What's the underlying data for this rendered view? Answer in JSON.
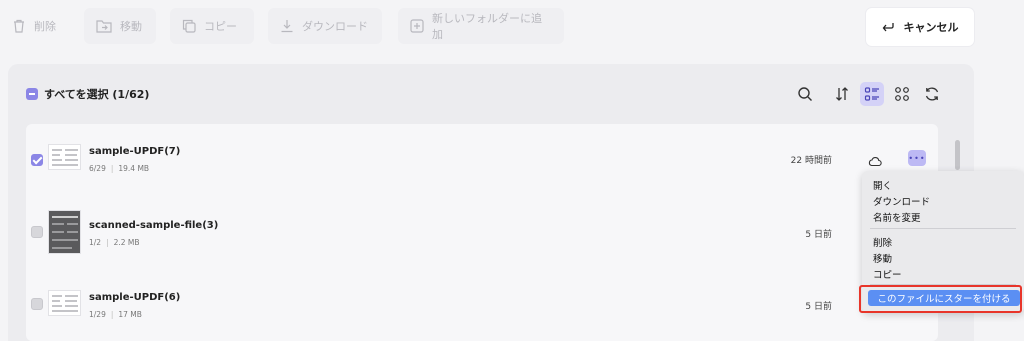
{
  "toolbar": {
    "delete_label": "削除",
    "move_label": "移動",
    "copy_label": "コピー",
    "download_label": "ダウンロード",
    "new_folder_label": "新しいフォルダーに追加",
    "cancel_label": "キャンセル"
  },
  "header": {
    "select_all_label": "すべてを選択 (1/62)"
  },
  "files": [
    {
      "name": "sample-UPDF(7)",
      "pages": "6/29",
      "size": "19.4 MB",
      "date": "22 時間前",
      "checked": true
    },
    {
      "name": "scanned-sample-file(3)",
      "pages": "1/2",
      "size": "2.2 MB",
      "date": "5 日前",
      "checked": false
    },
    {
      "name": "sample-UPDF(6)",
      "pages": "1/29",
      "size": "17 MB",
      "date": "5 日前",
      "checked": false
    }
  ],
  "context_menu": {
    "open": "開く",
    "download": "ダウンロード",
    "rename": "名前を変更",
    "delete": "削除",
    "move": "移動",
    "copy": "コピー",
    "star": "このファイルにスターを付ける"
  },
  "colors": {
    "accent": "#8b86e6",
    "menu_highlight": "#5b8ff3",
    "annotation_border": "#e8352a"
  }
}
